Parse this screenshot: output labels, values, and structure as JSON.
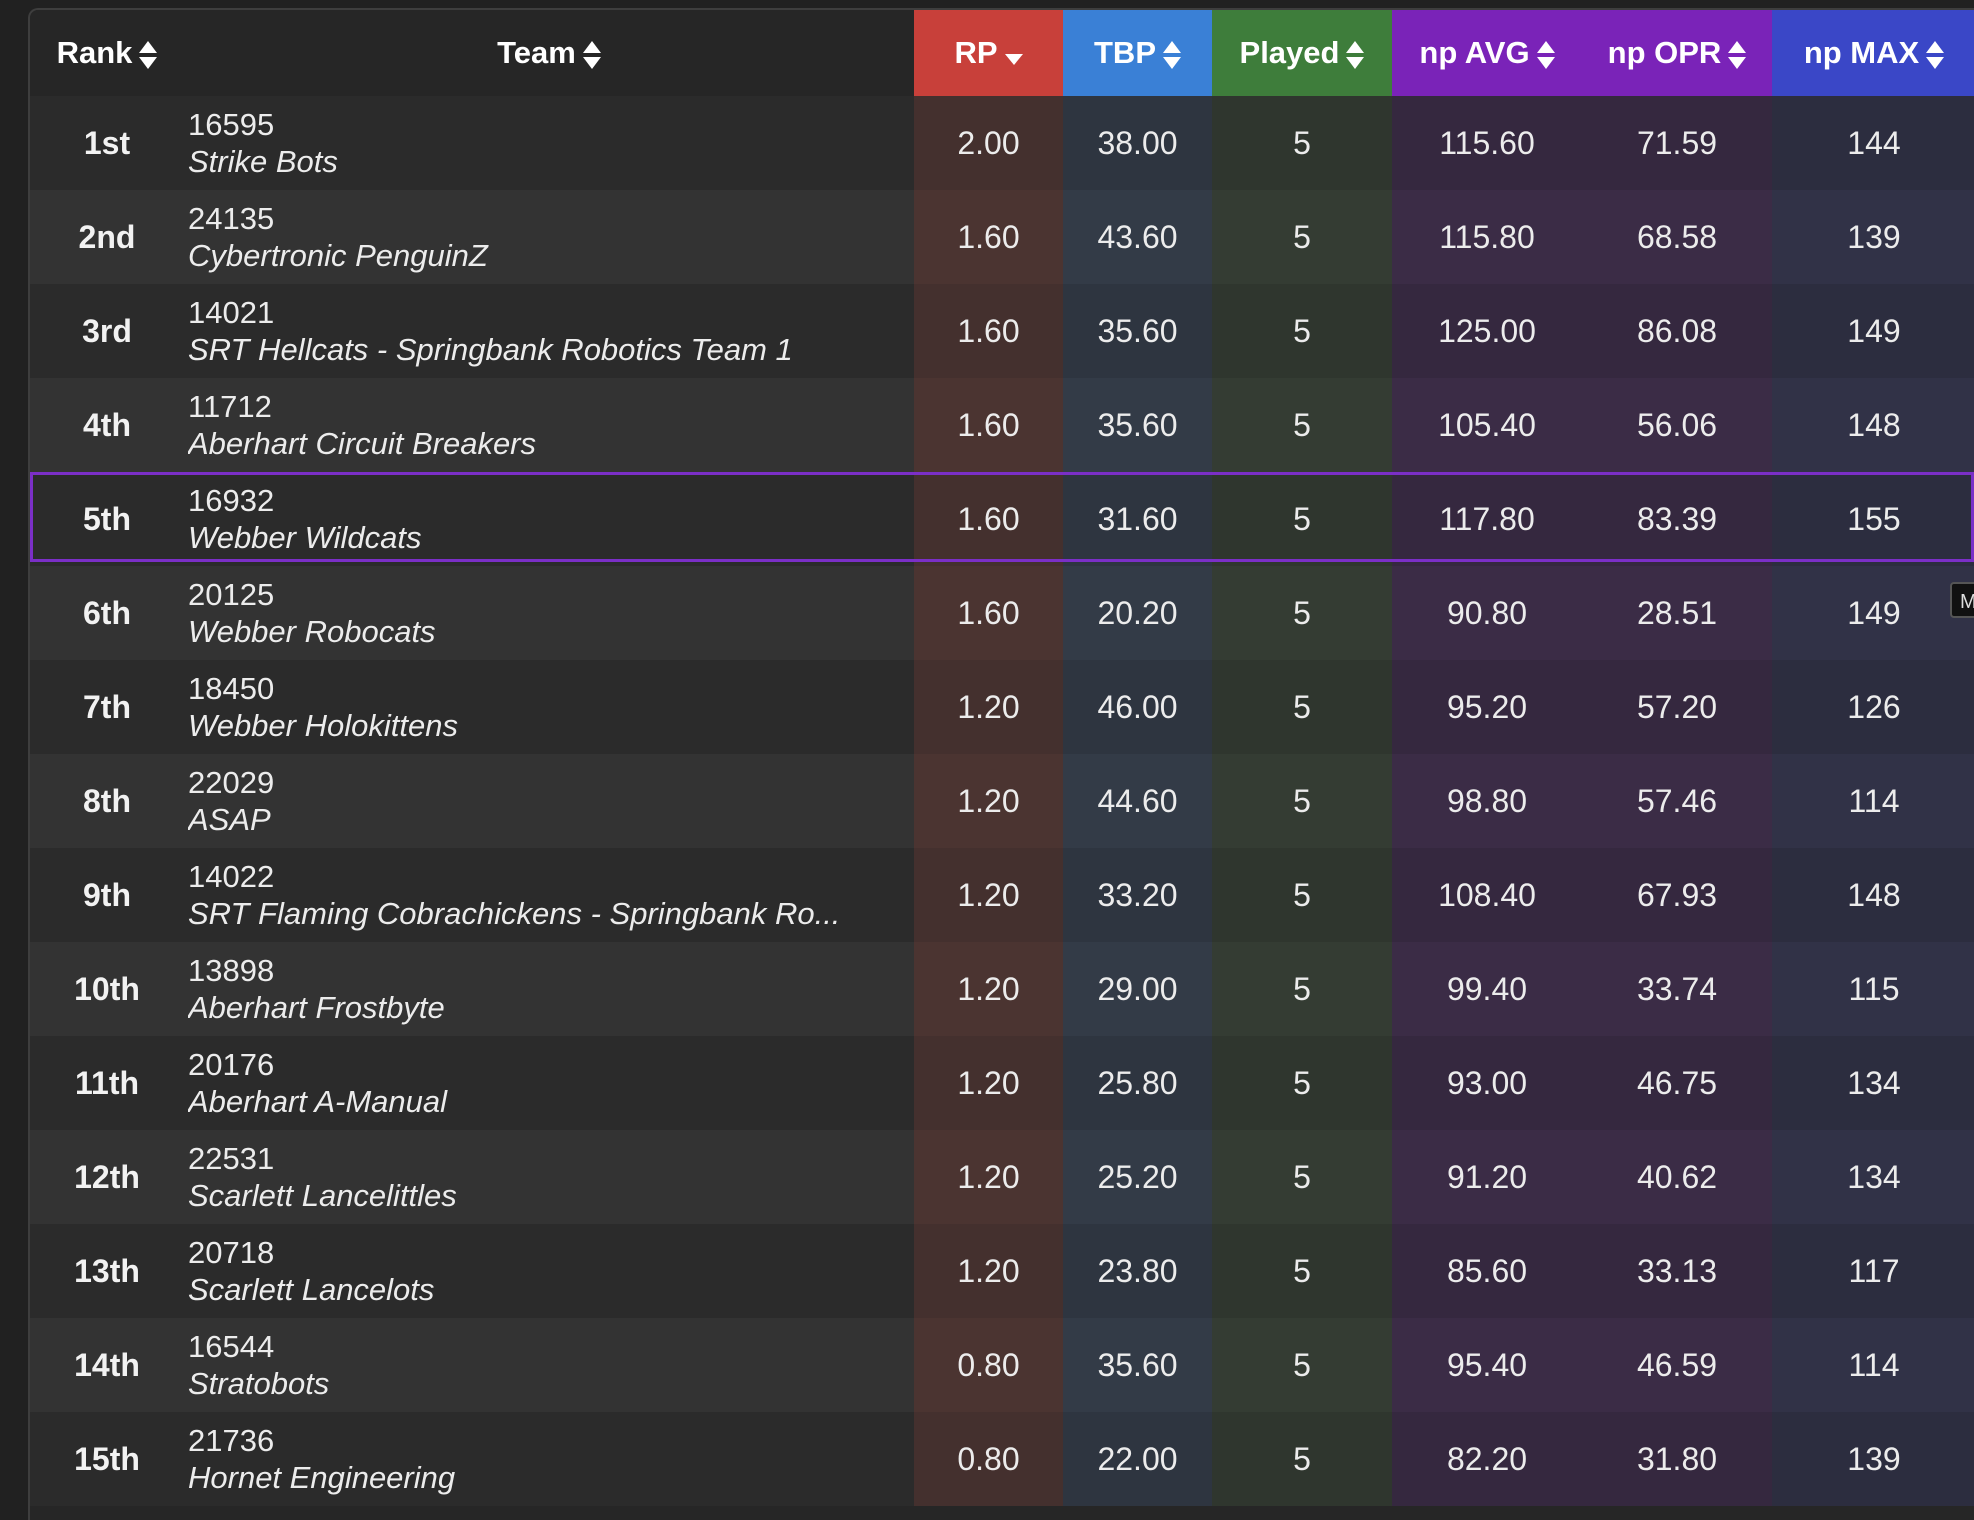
{
  "headers": {
    "rank": "Rank",
    "team": "Team",
    "rp": "RP",
    "tbp": "TBP",
    "played": "Played",
    "np_avg": "np AVG",
    "np_opr": "np OPR",
    "np_max": "np MAX"
  },
  "sort": {
    "column": "RP",
    "direction": "descending"
  },
  "colors": {
    "rp": "#c8403a",
    "tbp": "#3a80d6",
    "played": "#3e7d3b",
    "np": "#7a23b8",
    "np_max": "#3a47c7",
    "highlight_border": "#7b2fc7"
  },
  "highlighted_rank": "5th",
  "tooltip_text": "M",
  "rows": [
    {
      "rank": "1st",
      "number": "16595",
      "name": "Strike Bots",
      "rp": "2.00",
      "tbp": "38.00",
      "played": "5",
      "np_avg": "115.60",
      "np_opr": "71.59",
      "np_max": "144"
    },
    {
      "rank": "2nd",
      "number": "24135",
      "name": "Cybertronic PenguinZ",
      "rp": "1.60",
      "tbp": "43.60",
      "played": "5",
      "np_avg": "115.80",
      "np_opr": "68.58",
      "np_max": "139"
    },
    {
      "rank": "3rd",
      "number": "14021",
      "name": "SRT Hellcats - Springbank Robotics Team 1",
      "rp": "1.60",
      "tbp": "35.60",
      "played": "5",
      "np_avg": "125.00",
      "np_opr": "86.08",
      "np_max": "149"
    },
    {
      "rank": "4th",
      "number": "11712",
      "name": "Aberhart Circuit Breakers",
      "rp": "1.60",
      "tbp": "35.60",
      "played": "5",
      "np_avg": "105.40",
      "np_opr": "56.06",
      "np_max": "148"
    },
    {
      "rank": "5th",
      "number": "16932",
      "name": "Webber Wildcats",
      "rp": "1.60",
      "tbp": "31.60",
      "played": "5",
      "np_avg": "117.80",
      "np_opr": "83.39",
      "np_max": "155"
    },
    {
      "rank": "6th",
      "number": "20125",
      "name": "Webber Robocats",
      "rp": "1.60",
      "tbp": "20.20",
      "played": "5",
      "np_avg": "90.80",
      "np_opr": "28.51",
      "np_max": "149"
    },
    {
      "rank": "7th",
      "number": "18450",
      "name": "Webber Holokittens",
      "rp": "1.20",
      "tbp": "46.00",
      "played": "5",
      "np_avg": "95.20",
      "np_opr": "57.20",
      "np_max": "126"
    },
    {
      "rank": "8th",
      "number": "22029",
      "name": "ASAP",
      "rp": "1.20",
      "tbp": "44.60",
      "played": "5",
      "np_avg": "98.80",
      "np_opr": "57.46",
      "np_max": "114"
    },
    {
      "rank": "9th",
      "number": "14022",
      "name": "SRT Flaming Cobrachickens - Springbank Ro...",
      "rp": "1.20",
      "tbp": "33.20",
      "played": "5",
      "np_avg": "108.40",
      "np_opr": "67.93",
      "np_max": "148"
    },
    {
      "rank": "10th",
      "number": "13898",
      "name": "Aberhart Frostbyte",
      "rp": "1.20",
      "tbp": "29.00",
      "played": "5",
      "np_avg": "99.40",
      "np_opr": "33.74",
      "np_max": "115"
    },
    {
      "rank": "11th",
      "number": "20176",
      "name": "Aberhart A-Manual",
      "rp": "1.20",
      "tbp": "25.80",
      "played": "5",
      "np_avg": "93.00",
      "np_opr": "46.75",
      "np_max": "134"
    },
    {
      "rank": "12th",
      "number": "22531",
      "name": "Scarlett Lancelittles",
      "rp": "1.20",
      "tbp": "25.20",
      "played": "5",
      "np_avg": "91.20",
      "np_opr": "40.62",
      "np_max": "134"
    },
    {
      "rank": "13th",
      "number": "20718",
      "name": "Scarlett Lancelots",
      "rp": "1.20",
      "tbp": "23.80",
      "played": "5",
      "np_avg": "85.60",
      "np_opr": "33.13",
      "np_max": "117"
    },
    {
      "rank": "14th",
      "number": "16544",
      "name": "Stratobots",
      "rp": "0.80",
      "tbp": "35.60",
      "played": "5",
      "np_avg": "95.40",
      "np_opr": "46.59",
      "np_max": "114"
    },
    {
      "rank": "15th",
      "number": "21736",
      "name": "Hornet Engineering",
      "rp": "0.80",
      "tbp": "22.00",
      "played": "5",
      "np_avg": "82.20",
      "np_opr": "31.80",
      "np_max": "139"
    }
  ]
}
